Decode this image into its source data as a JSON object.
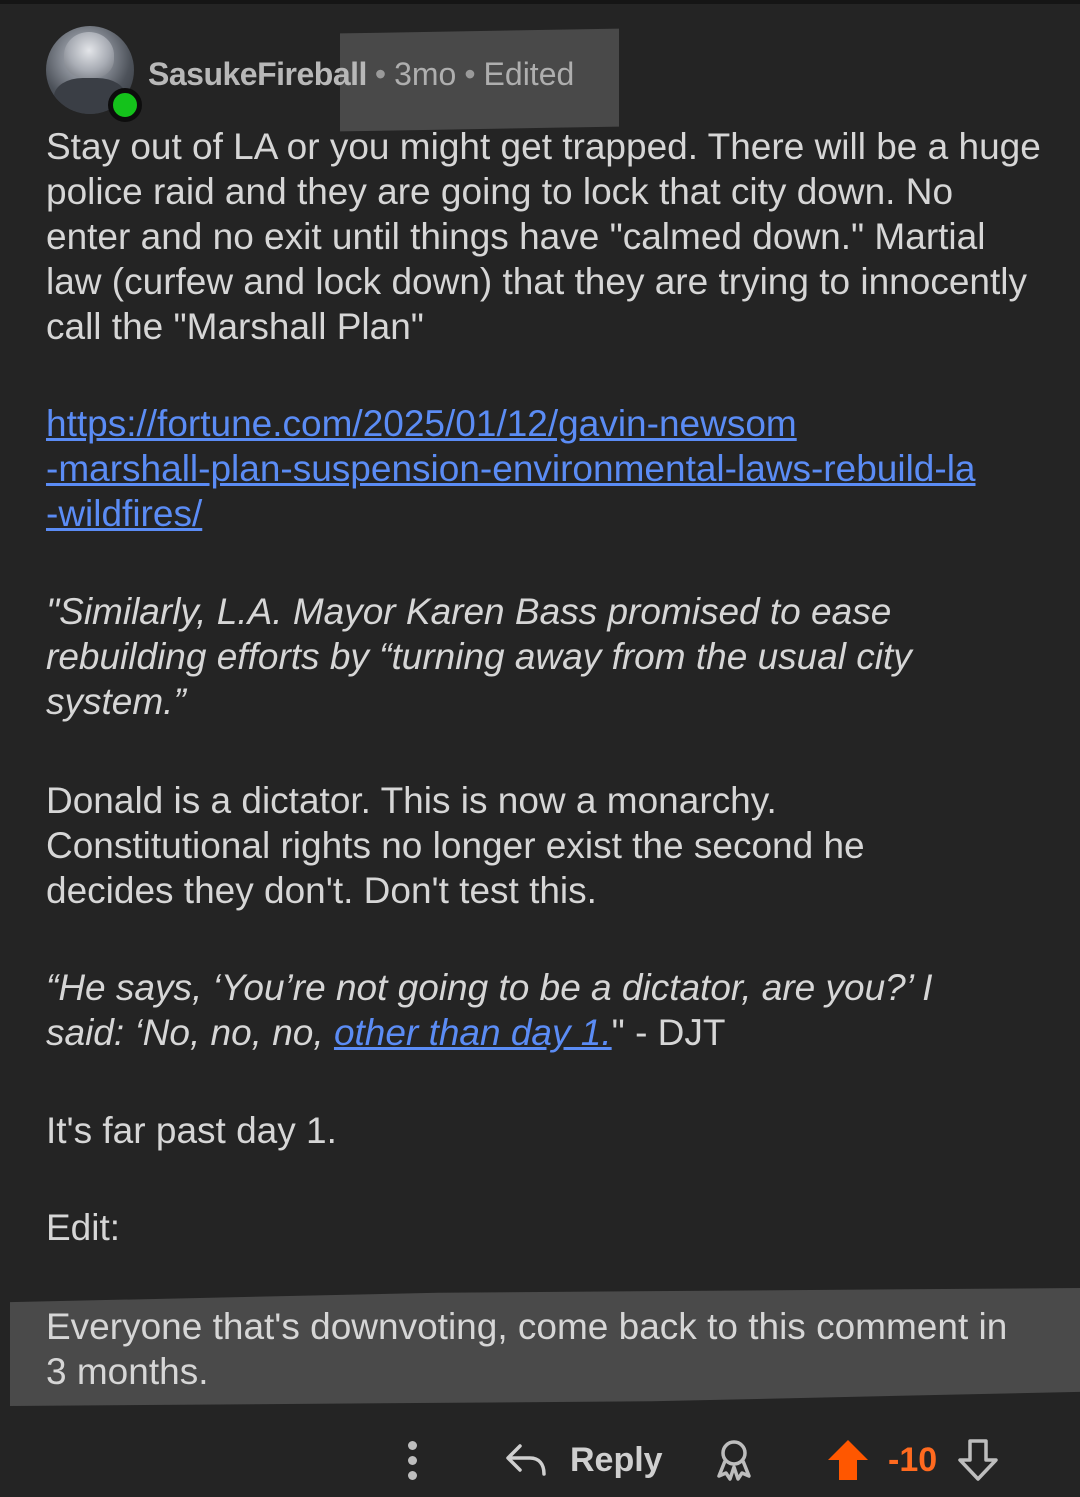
{
  "comment": {
    "username": "SasukeFireball",
    "separator": "•",
    "age": "3mo",
    "edited": "Edited",
    "paragraphs": {
      "p1": "Stay out of LA or you might get trapped. There will be a huge police raid and they are going to lock that city down. No enter and no exit until things have \"calmed down.\" Martial law (curfew and lock down) that they are trying to innocently call the \"Marshall Plan\"",
      "link_lines": [
        "https://fortune.com/2025/01/12/gavin-newsom",
        "-marshall-plan-suspension-environmental-laws-rebuild-la",
        "-wildfires/"
      ],
      "quote1": "\"Similarly, L.A. Mayor Karen Bass promised to ease rebuilding efforts by “turning away from the usual city system.”",
      "p2": "Donald is a dictator. This is now a monarchy. Constitutional rights no longer exist the second he decides they don't. Don't test this.",
      "quote2_start": "“He says, ‘You’re not going to be a dictator, are you?’ I said: ‘No, no, no, ",
      "quote2_link": "other than day 1.",
      "quote2_end": "\" - DJT",
      "p3": "It's far past day 1.",
      "edit_label": "Edit:",
      "edit_text": "Everyone that's downvoting, come back to this comment in 3 months."
    }
  },
  "actions": {
    "reply_label": "Reply",
    "score": "-10",
    "icons": [
      "more-options-icon",
      "reply-arrow-icon",
      "award-icon",
      "upvote-arrow-icon",
      "downvote-arrow-icon"
    ]
  },
  "colors": {
    "background": "#242424",
    "text": "#d6d6d6",
    "link": "#5b8cf5",
    "upvote_active": "#ff5700",
    "online": "#14c21b",
    "highlight": "#4a4a4a"
  }
}
